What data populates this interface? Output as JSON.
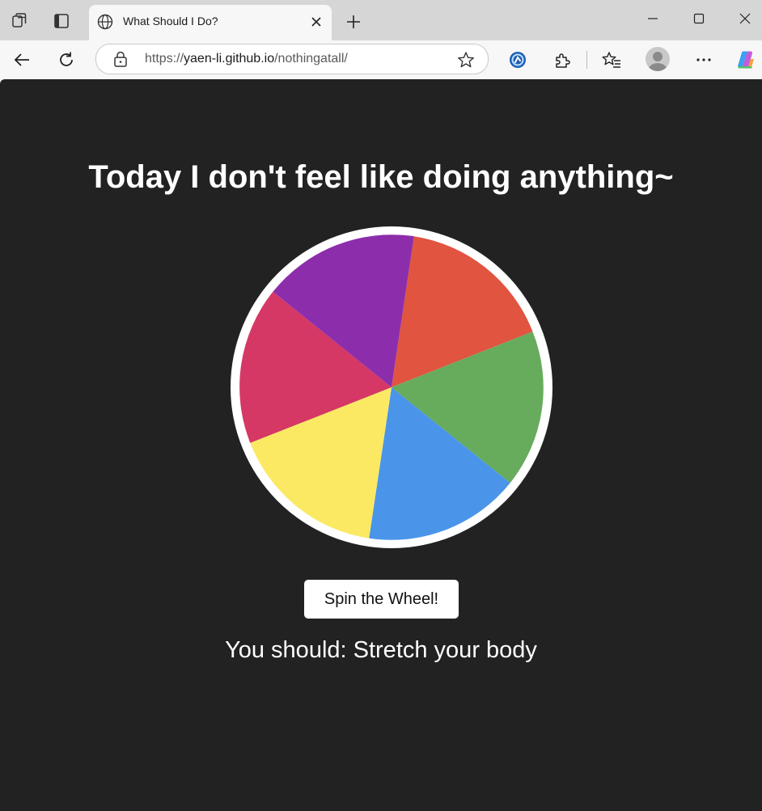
{
  "browser": {
    "tab": {
      "title": "What Should I Do?"
    },
    "url": {
      "scheme": "https://",
      "host": "yaen-li.github.io",
      "path": "/nothingatall/"
    }
  },
  "page": {
    "heading": "Today I don't feel like doing anything~",
    "spin_button_label": "Spin the Wheel!",
    "result_text": "You should: Stretch your body"
  },
  "wheel": {
    "rim_color": "#ffffff",
    "segment_colors": [
      "#e05440",
      "#67ab5d",
      "#4a95e9",
      "#fbe964",
      "#d53864",
      "#8c2eab"
    ]
  },
  "icons": {
    "workspaces": "workspaces-icon",
    "tab_actions": "tab-actions-icon",
    "globe": "globe-icon",
    "close": "close-icon",
    "new_tab": "plus-icon",
    "minimize": "minimize-icon",
    "maximize": "maximize-icon",
    "close_window": "close-window-icon",
    "back": "back-arrow-icon",
    "refresh": "refresh-icon",
    "site_info": "lock-icon",
    "favorite": "star-icon",
    "extension_app": "extension-app-icon",
    "extensions": "puzzle-icon",
    "favorites": "favorites-icon",
    "profile": "profile-avatar-icon",
    "more": "more-icon",
    "copilot": "copilot-icon"
  }
}
